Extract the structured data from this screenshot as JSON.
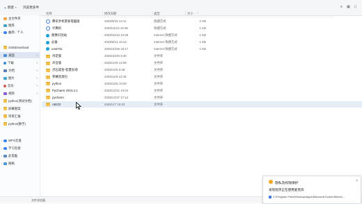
{
  "toolbar": {
    "new_label": "新建",
    "view_more_label": "浏览更多件"
  },
  "columns": {
    "name": "名称",
    "date": "修改日期",
    "type": "类型",
    "size": "大小"
  },
  "sidebar": {
    "items": [
      {
        "label": "主文件夹",
        "icon": "home-icon"
      },
      {
        "label": "图库",
        "icon": "gallery-icon"
      },
      {
        "label": "曲雨 - 个人",
        "icon": "cloud-icon"
      },
      {
        "label": "2345Download",
        "icon": "folder-icon"
      },
      {
        "label": "桌面",
        "icon": "desktop-icon"
      },
      {
        "label": "下载",
        "icon": "download-icon"
      },
      {
        "label": "文档",
        "icon": "document-icon"
      },
      {
        "label": "图片",
        "icon": "picture-icon"
      },
      {
        "label": "音乐",
        "icon": "music-icon"
      },
      {
        "label": "视频",
        "icon": "video-icon"
      },
      {
        "label": "python(测试文档)",
        "icon": "folder-icon"
      },
      {
        "label": "屏幕图案",
        "icon": "folder-icon"
      },
      {
        "label": "项目汇报",
        "icon": "folder-icon"
      },
      {
        "label": "python(数学)",
        "icon": "folder-icon"
      },
      {
        "label": "WPS云盘",
        "icon": "cloud-icon"
      },
      {
        "label": "学习云盘",
        "icon": "cloud-icon"
      },
      {
        "label": "此电脑",
        "icon": "pc-icon"
      },
      {
        "label": "网络",
        "icon": "network-icon"
      }
    ]
  },
  "files": [
    {
      "name": "腾讯手机管家电脑版",
      "date": "2025/5/18 12:11",
      "type": "快捷方式",
      "size": "2 KB",
      "icon": "shortcut-icon"
    },
    {
      "name": "计算机",
      "date": "2025/11/12 10:36",
      "type": "快捷方式",
      "size": "1 KB",
      "icon": "shortcut-icon"
    },
    {
      "name": "图像识别站",
      "date": "2025/10/12 12:06",
      "type": "Internet 快捷方式",
      "size": "1 KB",
      "icon": "edge-icon"
    },
    {
      "name": "必备",
      "date": "2025/6/12 16:24",
      "type": "Internet 快捷方式",
      "size": "1 KB",
      "icon": "edge-icon"
    },
    {
      "name": "unst731",
      "date": "2025/10/25 15:17",
      "type": "Internet 快捷方式",
      "size": "1 KB",
      "icon": "edge-icon"
    },
    {
      "name": "待定版",
      "date": "2025/10/25 8:46",
      "type": "文件夹",
      "size": "",
      "icon": "folder-icon"
    },
    {
      "name": "声音版",
      "date": "2025/12/6 14:09",
      "type": "文件夹",
      "size": "",
      "icon": "folder-icon"
    },
    {
      "name": "点石成金-智慧农场",
      "date": "2025/12/6 9:48",
      "type": "文件夹",
      "size": "",
      "icon": "folder-icon"
    },
    {
      "name": "参赛资源包",
      "date": "2025/11/9 12:45",
      "type": "文件夹",
      "size": "",
      "icon": "folder-icon"
    },
    {
      "name": "python",
      "date": "2025/12/6 15:09",
      "type": "文件夹",
      "size": "",
      "icon": "folder-icon"
    },
    {
      "name": "PyCharm 2024.2.1",
      "date": "2025/12/21 10:04",
      "type": "文件夹",
      "size": "",
      "icon": "folder-icon"
    },
    {
      "name": "pycharm",
      "date": "2025/12/27 17:14",
      "type": "文件夹",
      "size": "",
      "icon": "folder-icon"
    },
    {
      "name": "ABCD",
      "date": "2026/1/7 16:33",
      "type": "文件夹",
      "size": "",
      "icon": "folder-icon"
    }
  ],
  "statusbar": {
    "text": "文件浏览器"
  },
  "notification": {
    "title": "隐私及权限保护",
    "message": "发现程序正在使用麦克风",
    "path": "C:\\Program Files\\WindowsApps\\Microsoft.ScreenSketch..."
  },
  "colors": {
    "selected_row": "#e6eef8",
    "accent": "#3a7bd5",
    "folder": "#f2c14e"
  }
}
